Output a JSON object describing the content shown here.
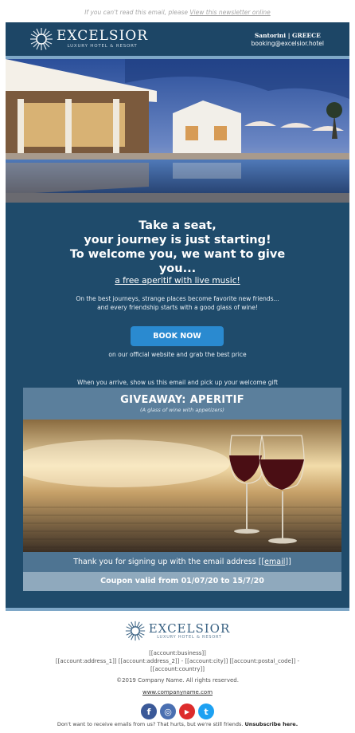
{
  "preheader": {
    "text": "If you can't read this email, please ",
    "link": "View this newsletter online"
  },
  "header": {
    "brand": "EXCELSIOR",
    "tagline": "LUXURY HOTEL & RESORT",
    "location": "Santorini | GREECE",
    "email": "booking@excelsior.hotel"
  },
  "hero": {
    "icon": "pool-resort-photo"
  },
  "headline": {
    "lines": [
      "Take a seat,",
      "your journey is just starting!",
      "To welcome you, we want to give",
      "you..."
    ],
    "offer": "a free aperitif with live music!"
  },
  "body": {
    "para_line1": "On the best journeys, strange places become favorite new friends...",
    "para_line2": "and every friendship starts with a good glass of wine!",
    "cta": "BOOK NOW",
    "cta_note": "on our official website and grab the best price",
    "arrive": "When you arrive, show us this email and pick up your welcome gift"
  },
  "card": {
    "title": "GIVEAWAY: APERITIF",
    "subtitle": "(A glass of wine with appetizers)",
    "thanks": "Thank you for signing up with the email address [[",
    "thanks_link": "email",
    "thanks_end": "]]",
    "coupon": "Coupon valid from 01/07/20 to 15/7/20"
  },
  "footer": {
    "brand": "EXCELSIOR",
    "tagline": "LUXURY HOTEL & RESORT",
    "business": "[[account:business]]",
    "address_line": "[[account:address_1]] [[account:address_2]] - [[account:city]] [[account:postal_code]] -",
    "country": "[[account:country]]",
    "copyright": "©2019 Company Name. All rights reserved.",
    "website": "www.companyname.com",
    "social": [
      {
        "name": "facebook-icon",
        "glyph": "f",
        "color": "#3b5998"
      },
      {
        "name": "instagram-icon",
        "glyph": "◎",
        "color": "#4a6fb1"
      },
      {
        "name": "youtube-icon",
        "glyph": "▶",
        "color": "#dd2c2c"
      },
      {
        "name": "twitter-icon",
        "glyph": "t",
        "color": "#1da1f2"
      }
    ],
    "unsub_text": "Don't want to receive emails from us? That hurts, but we're still friends. ",
    "unsub_link": "Unsubscribe here."
  },
  "colors": {
    "frame": "#1f4b6b",
    "accent": "#2a8ad0",
    "stripe": "#7ea7c7"
  }
}
